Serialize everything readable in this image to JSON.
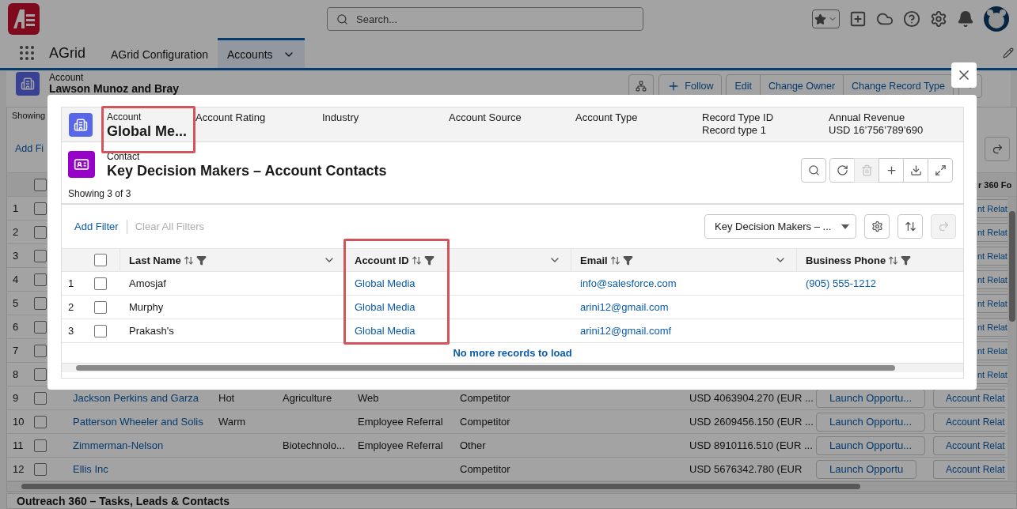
{
  "top_bar": {
    "search": {
      "placeholder": "Search..."
    }
  },
  "nav": {
    "app_name": "AGrid",
    "tabs": [
      {
        "label": "AGrid Configuration",
        "selected": false
      },
      {
        "label": "Accounts",
        "selected": true
      }
    ]
  },
  "record_header": {
    "object_type": "Account",
    "name": "Lawson Munoz and Bray",
    "follow_button": "Follow",
    "action_buttons": [
      "Edit",
      "Change Owner",
      "Change Record Type"
    ]
  },
  "related_list": {
    "showing": "Showing",
    "add_filter": "Add Fi",
    "select_all": {
      "checked": false
    },
    "partial_column": "r 360 Fo",
    "rows": [
      {
        "kind": "covered",
        "number": "1",
        "checked": false,
        "partial_action": "nt Relat"
      },
      {
        "kind": "covered",
        "number": "2",
        "checked": false,
        "partial_action": "nt Relat"
      },
      {
        "kind": "covered",
        "number": "3",
        "checked": false,
        "partial_action": "nt Relat"
      },
      {
        "kind": "covered",
        "number": "4",
        "checked": false,
        "partial_action": "nt Relat"
      },
      {
        "kind": "covered",
        "number": "5",
        "checked": false,
        "partial_action": "nt Relat"
      },
      {
        "kind": "covered",
        "number": "6",
        "checked": false,
        "partial_action": "nt Relat"
      },
      {
        "kind": "covered",
        "number": "7",
        "checked": false,
        "partial_action": "nt Relat"
      },
      {
        "kind": "covered",
        "number": "8",
        "checked": false,
        "partial_action": "nt Relat"
      },
      {
        "kind": "full",
        "number": "9",
        "checked": false,
        "name": "Jackson Perkins and Garza",
        "rating": "Hot",
        "industry": "Agriculture",
        "source": "Web",
        "type": "Competitor",
        "revenue": "USD 4063904.270 (EUR ...",
        "action_1": "Launch Opportu...",
        "action_2": "Account Relat"
      },
      {
        "kind": "full",
        "number": "10",
        "checked": false,
        "name": "Patterson Wheeler and Solis",
        "rating": "Warm",
        "source": "Employee Referral",
        "type": "Competitor",
        "revenue": "USD 2609456.150 (EUR ...",
        "action_1": "Launch Opportu...",
        "action_2": "Account Relat"
      },
      {
        "kind": "full",
        "number": "11",
        "checked": false,
        "name": "Zimmerman-Nelson",
        "industry": "Biotechnolo...",
        "source": "Employee Referral",
        "type": "Other",
        "revenue": "USD 8910116.510 (EUR ...",
        "action_1": "Launch Opportu...",
        "action_2": "Account Relat"
      },
      {
        "kind": "full",
        "number": "12",
        "checked": false,
        "name": "Ellis Inc",
        "type": "Competitor",
        "revenue": "USD 5676342.780 (EUR",
        "action_1": "Launch Opportu",
        "action_2": "Account Relat"
      }
    ]
  },
  "section": {
    "title": "Outreach 360 – Tasks, Leads & Contacts"
  },
  "modal": {
    "account": {
      "label": "Account",
      "name": "Global Me...",
      "highlighted": true,
      "fields": [
        {
          "label": "Account Rating"
        },
        {
          "label": "Industry"
        },
        {
          "label": "Account Source"
        },
        {
          "label": "Account Type"
        },
        {
          "label": "Record Type ID",
          "value": "Record type 1"
        },
        {
          "label": "Annual Revenue",
          "value": "USD 16’756’789’690"
        }
      ]
    },
    "list": {
      "object_type": "Contact",
      "title": "Key Decision Makers – Account Contacts",
      "count": "Showing 3 of 3",
      "toolbar": [
        {
          "kind": "search",
          "disabled": false
        },
        {
          "kind": "refresh",
          "disabled": false
        },
        {
          "kind": "delete",
          "disabled": true
        },
        {
          "kind": "add",
          "disabled": false
        },
        {
          "kind": "download",
          "disabled": false
        },
        {
          "kind": "expand",
          "disabled": false
        }
      ],
      "add_filter": "Add Filter",
      "clear_filters": {
        "label": "Clear All Filters",
        "disabled": true
      },
      "view_select": {
        "value": "Key Decision Makers – ..."
      },
      "view_tools": [
        {
          "kind": "settings",
          "disabled": false
        },
        {
          "kind": "sort",
          "disabled": false
        },
        {
          "kind": "redo",
          "disabled": true
        }
      ],
      "select_all": {
        "checked": false
      },
      "columns": [
        {
          "label": "Last Name",
          "kind": "text",
          "highlighted": false
        },
        {
          "label": "Account ID",
          "kind": "link",
          "highlighted": true
        },
        {
          "label": "Email",
          "kind": "link",
          "highlighted": false
        },
        {
          "label": "Business Phone",
          "kind": "link",
          "highlighted": false
        }
      ],
      "rows": [
        {
          "number": "1",
          "checked": false,
          "cells": [
            "Amosjaf",
            "Global Media",
            "info@salesforce.com",
            "(905) 555-1212"
          ]
        },
        {
          "number": "2",
          "checked": false,
          "cells": [
            "Murphy",
            "Global Media",
            "arini12@gmail.com"
          ]
        },
        {
          "number": "3",
          "checked": false,
          "cells": [
            "Prakash's",
            "Global Media",
            "arini12@gmail.comf"
          ]
        }
      ],
      "footer": "No more records to load"
    }
  }
}
